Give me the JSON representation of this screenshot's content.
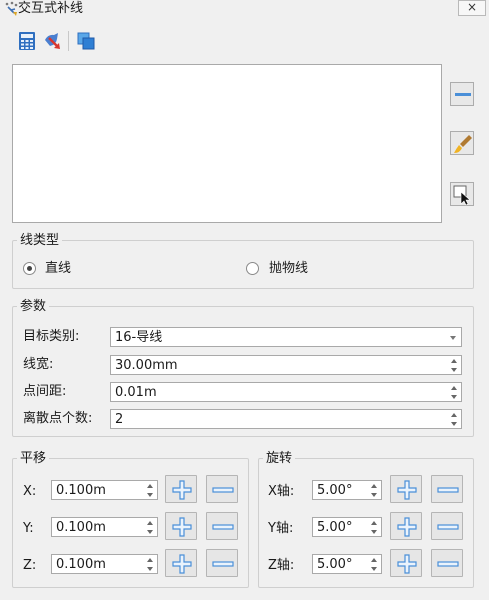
{
  "window": {
    "title": "交互式补线",
    "close_label": "×"
  },
  "toolbar": {
    "icons": [
      "calculator-icon",
      "brush-select-icon",
      "layers-icon"
    ]
  },
  "side_buttons": [
    "minus-line-icon",
    "paint-brush-icon",
    "select-cursor-icon"
  ],
  "line_type": {
    "title": "线类型",
    "options": [
      {
        "label": "直线",
        "checked": true
      },
      {
        "label": "抛物线",
        "checked": false
      }
    ]
  },
  "params": {
    "title": "参数",
    "target_label": "目标类别:",
    "target_value": "16-导线",
    "width_label": "线宽:",
    "width_value": "30.00mm",
    "spacing_label": "点间距:",
    "spacing_value": "0.01m",
    "count_label": "离散点个数:",
    "count_value": "2"
  },
  "translate": {
    "title": "平移",
    "x_label": "X:",
    "x_value": "0.100m",
    "y_label": "Y:",
    "y_value": "0.100m",
    "z_label": "Z:",
    "z_value": "0.100m"
  },
  "rotate": {
    "title": "旋转",
    "x_label": "X轴:",
    "x_value": "5.00°",
    "y_label": "Y轴:",
    "y_value": "5.00°",
    "z_label": "Z轴:",
    "z_value": "5.00°"
  },
  "colors": {
    "plus_blue": "#4a8fd8",
    "minus_blue": "#4a8fd8",
    "window_bg": "#f0f0f0"
  }
}
